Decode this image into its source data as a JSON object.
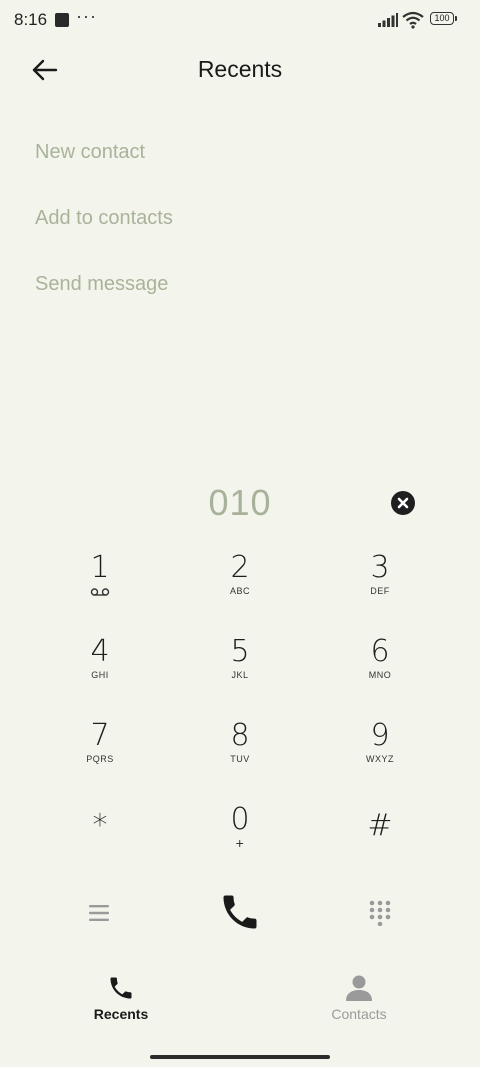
{
  "status_bar": {
    "time": "8:16",
    "more": "···",
    "battery": "100"
  },
  "header": {
    "title": "Recents"
  },
  "options": [
    {
      "label": "New contact"
    },
    {
      "label": "Add to contacts"
    },
    {
      "label": "Send message"
    }
  ],
  "dialer": {
    "number": "010"
  },
  "keypad": [
    {
      "digit": "1",
      "letters": ""
    },
    {
      "digit": "2",
      "letters": "ABC"
    },
    {
      "digit": "3",
      "letters": "DEF"
    },
    {
      "digit": "4",
      "letters": "GHI"
    },
    {
      "digit": "5",
      "letters": "JKL"
    },
    {
      "digit": "6",
      "letters": "MNO"
    },
    {
      "digit": "7",
      "letters": "PQRS"
    },
    {
      "digit": "8",
      "letters": "TUV"
    },
    {
      "digit": "9",
      "letters": "WXYZ"
    },
    {
      "digit": "*",
      "letters": ""
    },
    {
      "digit": "0",
      "letters": "+"
    },
    {
      "digit": "#",
      "letters": ""
    }
  ],
  "bottom_nav": [
    {
      "label": "Recents",
      "icon": "phone-icon",
      "active": true
    },
    {
      "label": "Contacts",
      "icon": "person-icon",
      "active": false
    }
  ],
  "colors": {
    "background": "#f3f4ec",
    "muted": "#a9b39a",
    "inactive": "#9a9a9a"
  }
}
